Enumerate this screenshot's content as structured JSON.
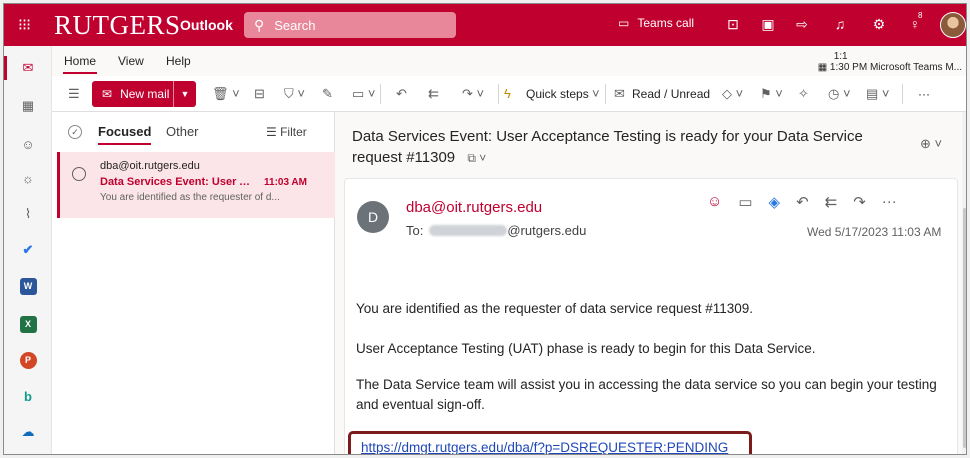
{
  "colors": {
    "brand": "#c0002f",
    "link": "#1f47b8",
    "highlight_box": "#7b1b1b"
  },
  "topbar": {
    "brand": "RUTGERS",
    "app_name": "Outlook",
    "search_placeholder": "Search",
    "teams_call": "Teams call"
  },
  "tabs": {
    "home": "Home",
    "view": "View",
    "help": "Help"
  },
  "teams_note": {
    "line1": "1:1",
    "line2": "1:30 PM Microsoft Teams M..."
  },
  "ribbon": {
    "new_mail": "New mail",
    "quick_steps": "Quick steps",
    "read_unread": "Read / Unread",
    "more": "···"
  },
  "list": {
    "focused": "Focused",
    "other": "Other",
    "filter": "Filter",
    "items": [
      {
        "from": "dba@oit.rutgers.edu",
        "subject": "Data Services Event: User A...",
        "time": "11:03 AM",
        "preview": "You are identified as the requester of d..."
      }
    ]
  },
  "message": {
    "subject": "Data Services Event: User Acceptance Testing is ready for your Data Service request #11309",
    "sender_initial": "D",
    "sender": "dba@oit.rutgers.edu",
    "to_label": "To:",
    "to_domain": "@rutgers.edu",
    "date": "Wed 5/17/2023 11:03 AM",
    "paragraphs": [
      "You are identified as the requester of data service request #11309.",
      "User Acceptance Testing (UAT) phase is ready to begin for this Data Service.",
      "The Data Service team will assist you in accessing the data service so you can begin your testing and eventual sign-off."
    ],
    "link": "https://dmgt.rutgers.edu/dba/f?p=DSREQUESTER:PENDING"
  }
}
